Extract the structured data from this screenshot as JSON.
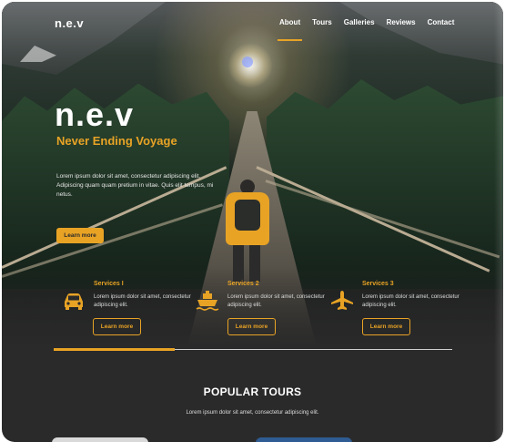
{
  "brand": {
    "logo": "n.e.v"
  },
  "nav": {
    "items": [
      {
        "label": "About",
        "active": true
      },
      {
        "label": "Tours",
        "active": false
      },
      {
        "label": "Galleries",
        "active": false
      },
      {
        "label": "Reviews",
        "active": false
      },
      {
        "label": "Contact",
        "active": false
      }
    ]
  },
  "hero": {
    "title": "n.e.v",
    "subtitle": "Never Ending Voyage",
    "description": "Lorem ipsum dolor sit amet, consectetur adipiscing elit. Adipiscing quam quam pretium in vitae. Quis elit tempus, mi netus.",
    "button_label": "Learn more"
  },
  "services": [
    {
      "icon": "car-icon",
      "title": "Services I",
      "description": "Lorem ipsum dolor sit amet, consectetur adipiscing elit.",
      "button_label": "Learn more"
    },
    {
      "icon": "ship-icon",
      "title": "Services 2",
      "description": "Lorem ipsum dolor sit amet, consectetur adipiscing elit.",
      "button_label": "Learn more"
    },
    {
      "icon": "airplane-icon",
      "title": "Services 3",
      "description": "Lorem ipsum dolor sit amet, consectetur adipiscing elit.",
      "button_label": "Learn more"
    }
  ],
  "popular_tours": {
    "title": "POPULAR TOURS",
    "description": "Lorem ipsum dolor sit amet, consectetur adipiscing elit."
  },
  "colors": {
    "accent": "#e8a325",
    "background": "#2a2a2a",
    "text": "#ffffff"
  }
}
